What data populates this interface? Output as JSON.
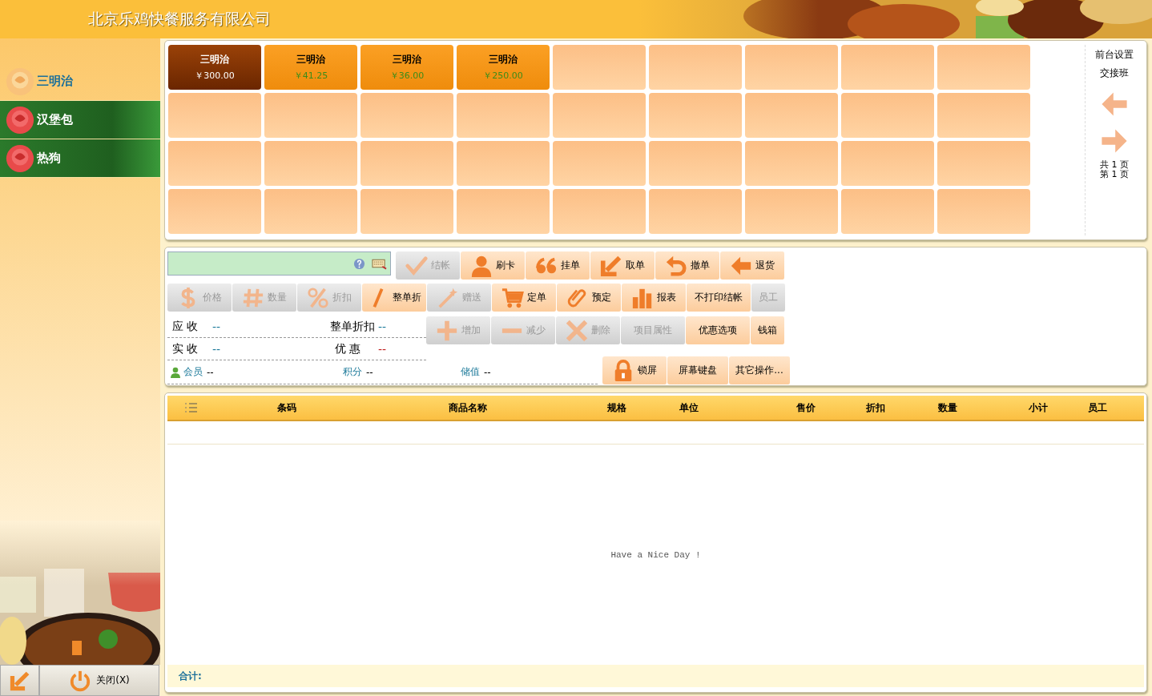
{
  "header": {
    "title": "北京乐鸡快餐服务有限公司"
  },
  "sidebar": {
    "categories": [
      {
        "label": "三明治",
        "selected": true
      },
      {
        "label": "汉堡包",
        "selected": false
      },
      {
        "label": "热狗",
        "selected": false
      }
    ],
    "buttons": [
      {
        "kind": "back"
      },
      {
        "kind": "power",
        "label": "关闭(X)"
      }
    ]
  },
  "products": [
    {
      "name": "三明治",
      "price": "￥300.00",
      "selected": true
    },
    {
      "name": "三明治",
      "price": "￥41.25",
      "selected": false
    },
    {
      "name": "三明治",
      "price": "￥36.00",
      "selected": false
    },
    {
      "name": "三明治",
      "price": "￥250.00",
      "selected": false
    }
  ],
  "side_links": [
    "前台设置",
    "交接班"
  ],
  "pager": {
    "total": "共 1 页",
    "current": "第 1 页"
  },
  "toolbar": {
    "row_1": [
      {
        "kind": "check",
        "label": "结帐",
        "disabled": true
      },
      {
        "kind": "user",
        "label": "刷卡",
        "disabled": false
      },
      {
        "kind": "quote",
        "label": "挂单",
        "disabled": false
      },
      {
        "kind": "downleft",
        "label": "取单",
        "disabled": false
      },
      {
        "kind": "undo",
        "label": "撤单",
        "disabled": false
      },
      {
        "kind": "left",
        "label": "退货",
        "disabled": false
      }
    ],
    "row_2": [
      {
        "kind": "dollar",
        "label": "价格",
        "disabled": true
      },
      {
        "kind": "hash",
        "label": "数量",
        "disabled": true
      },
      {
        "kind": "percent",
        "label": "折扣",
        "disabled": true
      },
      {
        "kind": "slash",
        "label": "整单折",
        "disabled": false
      },
      {
        "kind": "wand",
        "label": "赠送",
        "disabled": true
      },
      {
        "kind": "cart",
        "label": "定单",
        "disabled": false
      },
      {
        "kind": "clip",
        "label": "预定",
        "disabled": false
      },
      {
        "kind": "bars",
        "label": "报表",
        "disabled": false
      },
      {
        "kind": "text",
        "label": "不打印结帐",
        "disabled": false
      },
      {
        "kind": "small",
        "label": "员工",
        "disabled": true
      }
    ],
    "row_3": [
      {
        "kind": "plus",
        "label": "增加",
        "disabled": true
      },
      {
        "kind": "minus",
        "label": "减少",
        "disabled": true
      },
      {
        "kind": "cross",
        "label": "删除",
        "disabled": true
      },
      {
        "kind": "text",
        "label": "项目属性",
        "disabled": true
      },
      {
        "kind": "text",
        "label": "优惠选项",
        "disabled": false
      },
      {
        "kind": "small",
        "label": "钱箱",
        "disabled": false
      }
    ],
    "row_4": [
      {
        "kind": "lock",
        "label": "锁屏",
        "disabled": false
      },
      {
        "kind": "text",
        "label": "屏幕键盘",
        "disabled": false
      },
      {
        "kind": "text",
        "label": "其它操作...",
        "disabled": false
      }
    ]
  },
  "summary": {
    "receivable": {
      "label": "应 收",
      "value": "--"
    },
    "bill_discount": {
      "label": "整单折扣",
      "value": "--"
    },
    "received": {
      "label": "实 收",
      "value": "--"
    },
    "offer": {
      "label": "优 惠",
      "value": "--"
    },
    "member": {
      "label": "会员",
      "value": "--"
    },
    "points": {
      "label": "积分",
      "value": "--"
    },
    "balance": {
      "label": "储值",
      "value": "--"
    }
  },
  "table": {
    "columns": [
      "条码",
      "商品名称",
      "规格",
      "单位",
      "售价",
      "折扣",
      "数量",
      "小计",
      "员工"
    ],
    "empty_message": "Have a Nice Day !",
    "footer_label": "合计:"
  }
}
